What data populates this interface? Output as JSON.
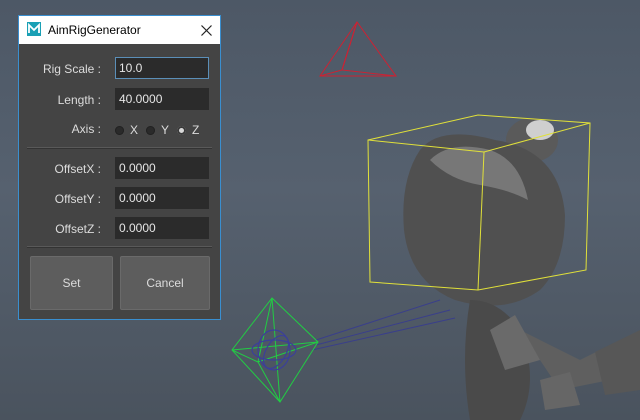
{
  "dialog": {
    "title": "AimRigGenerator",
    "icon": "maya-app-icon",
    "close_icon": "close-icon",
    "accent": "#3a8fd0"
  },
  "form": {
    "rig_scale": {
      "label": "Rig Scale :",
      "value": "10.0"
    },
    "length": {
      "label": "Length :",
      "value": "40.0000"
    },
    "axis": {
      "label": "Axis :",
      "options": [
        "X",
        "Y",
        "Z"
      ],
      "selected": "Z"
    },
    "offset_x": {
      "label": "OffsetX :",
      "value": "0.0000"
    },
    "offset_y": {
      "label": "OffsetY :",
      "value": "0.0000"
    },
    "offset_z": {
      "label": "OffsetZ :",
      "value": "0.0000"
    }
  },
  "buttons": {
    "set": "Set",
    "cancel": "Cancel"
  },
  "viewport": {
    "background": "#56616f",
    "locator_color": "#cc2233",
    "bbox_color": "#e0e03a",
    "aim_ctrl_color": "#22cc44"
  }
}
